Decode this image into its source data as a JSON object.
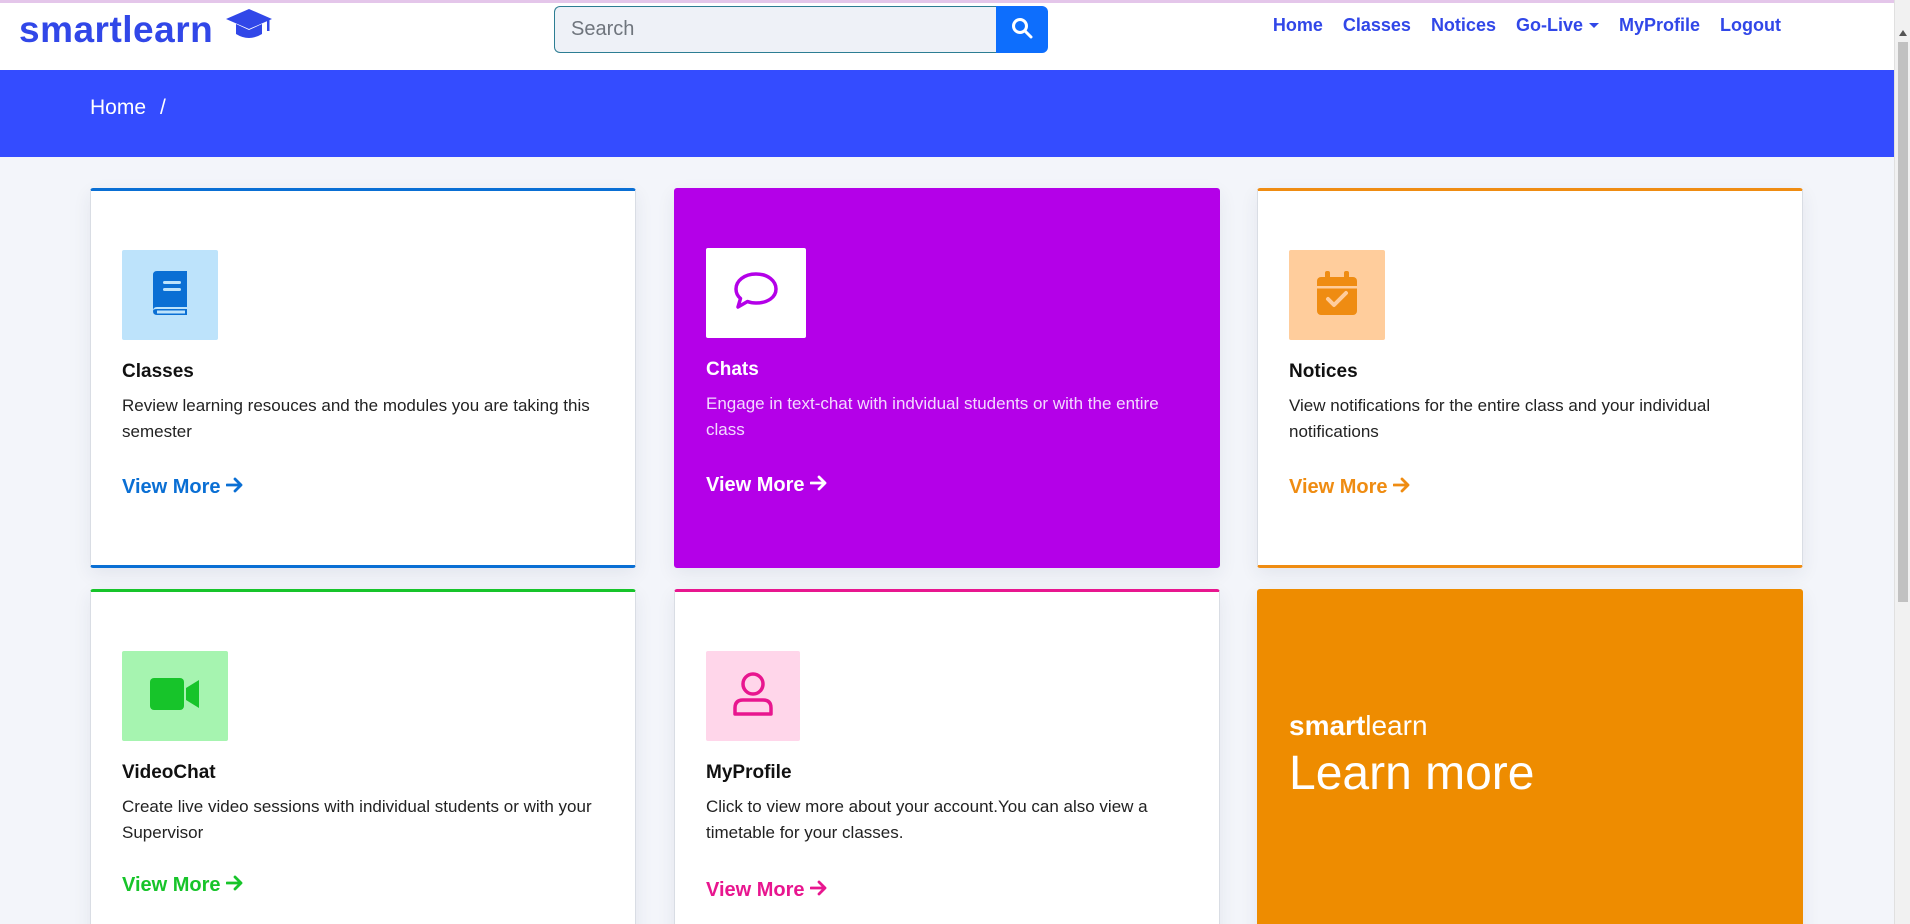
{
  "brand": {
    "name": "smartlearn",
    "icon": "graduation-cap-icon",
    "color": "#3147e8"
  },
  "search": {
    "placeholder": "Search",
    "value": "",
    "icon": "search-icon"
  },
  "nav": {
    "items": [
      "Home",
      "Classes",
      "Notices",
      "Go-Live",
      "MyProfile",
      "Logout"
    ]
  },
  "breadcrumb": {
    "items": [
      "Home",
      "/"
    ]
  },
  "colors": {
    "banner": "#344cff",
    "classes": "#0a6fd4",
    "chats": "#b400e8",
    "notices": "#ef8c12",
    "videochat": "#17c42a",
    "myprofile": "#e8168f",
    "promo": "#ee8c00"
  },
  "cards": [
    {
      "title": "Classes",
      "desc": "Review learning resouces and the modules you are taking this semester",
      "link": "View More",
      "icon": "book-icon"
    },
    {
      "title": "Chats",
      "desc": "Engage in text-chat with indvidual students or with the entire class",
      "link": "View More",
      "icon": "chat-bubble-icon"
    },
    {
      "title": "Notices",
      "desc": "View notifications for the entire class and your individual notifications",
      "link": "View More",
      "icon": "calendar-check-icon"
    },
    {
      "title": "VideoChat",
      "desc": "Create live video sessions with individual students or with your Supervisor",
      "link": "View More",
      "icon": "video-camera-icon"
    },
    {
      "title": "MyProfile",
      "desc": "Click to view more about your account.You can also view a timetable for your classes.",
      "link": "View More",
      "icon": "person-icon"
    }
  ],
  "promo": {
    "brand_bold": "smart",
    "brand_light": "learn",
    "cta": "Learn more"
  }
}
